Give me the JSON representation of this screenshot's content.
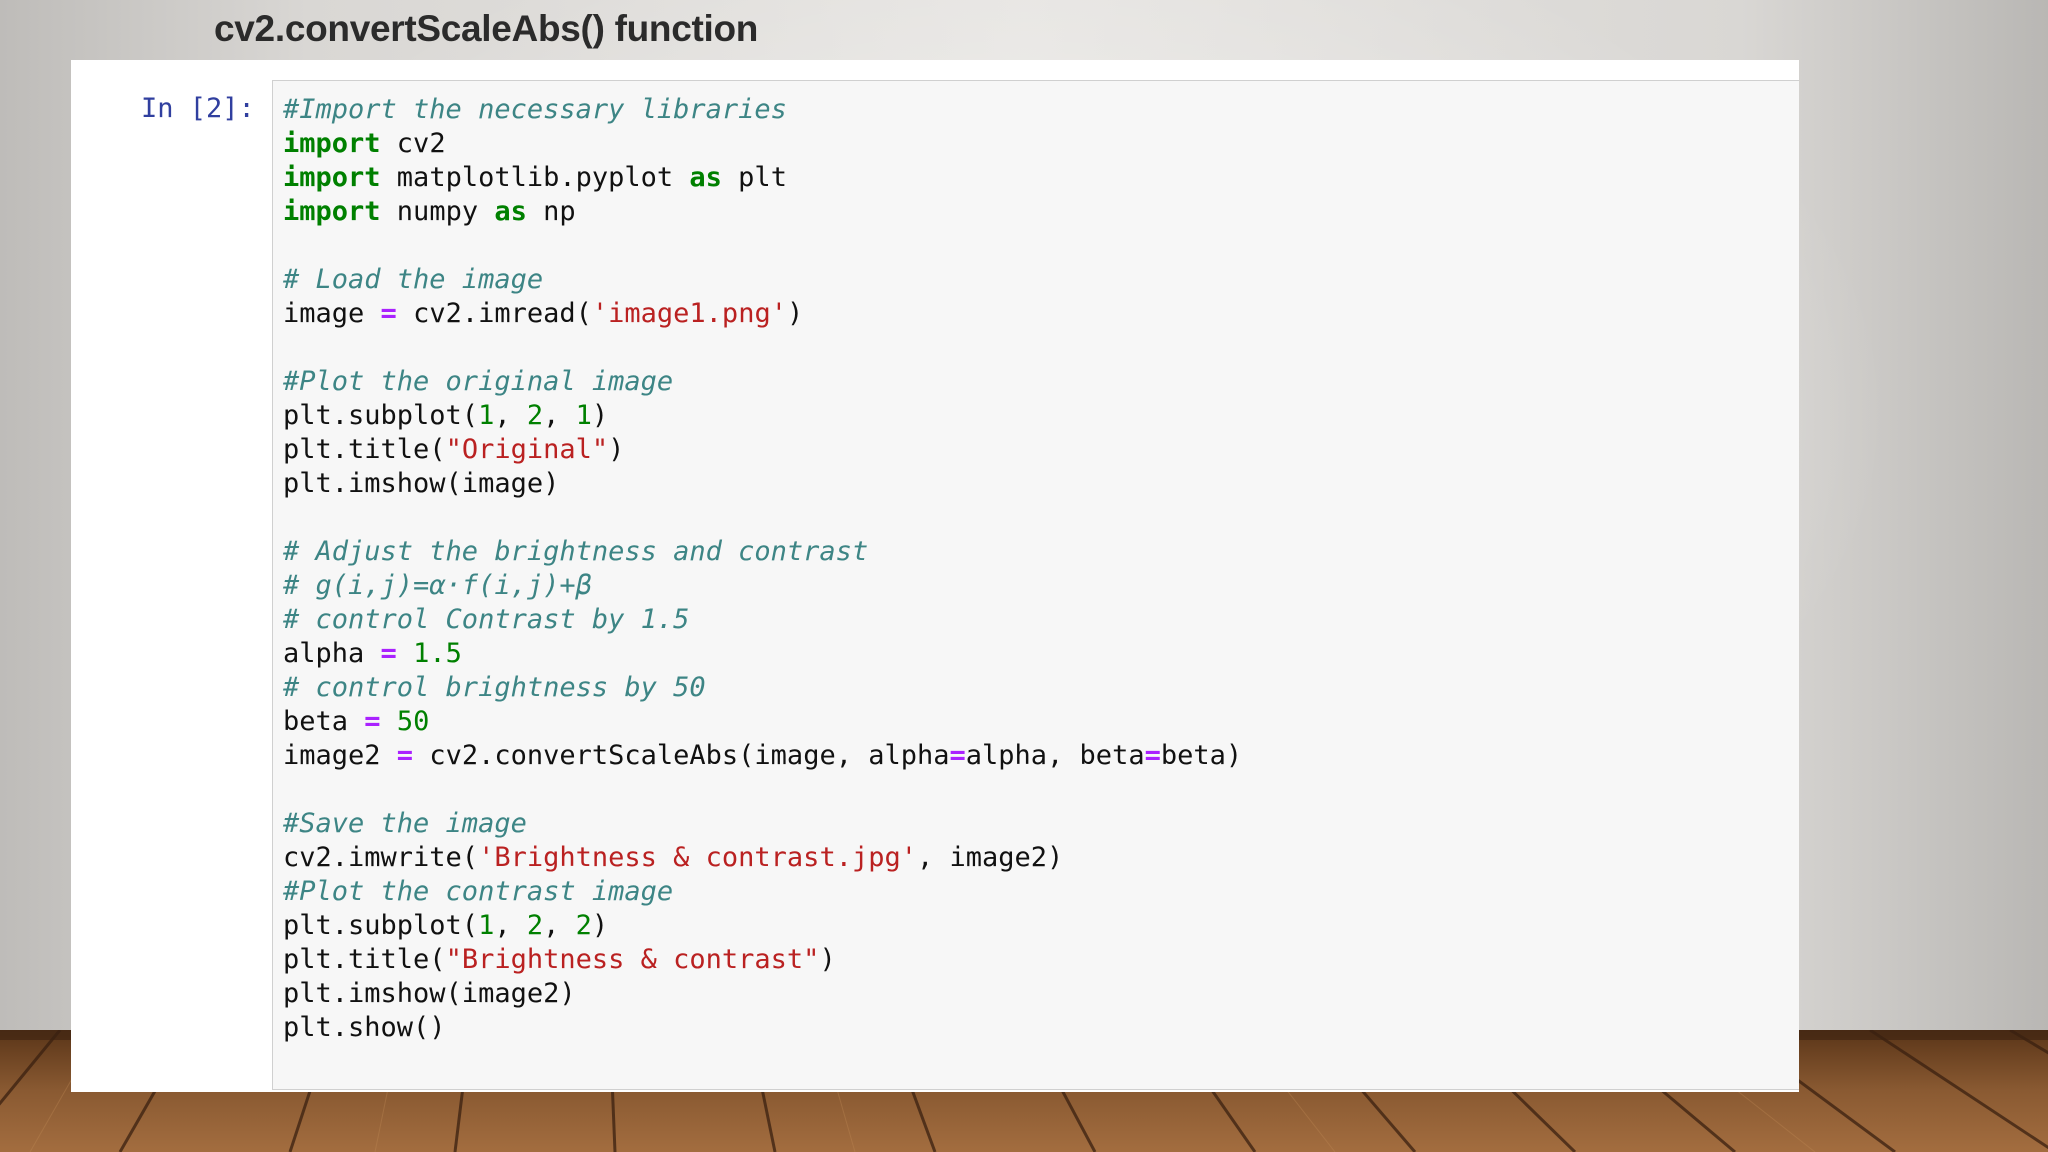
{
  "slide": {
    "title": "cv2.convertScaleAbs() function"
  },
  "cell": {
    "prompt": "In [2]:",
    "lines": [
      [
        {
          "t": "comment",
          "v": "#Import the necessary libraries"
        }
      ],
      [
        {
          "t": "keyword",
          "v": "import"
        },
        {
          "t": "text",
          "v": " cv2"
        }
      ],
      [
        {
          "t": "keyword",
          "v": "import"
        },
        {
          "t": "text",
          "v": " matplotlib.pyplot "
        },
        {
          "t": "keyword",
          "v": "as"
        },
        {
          "t": "text",
          "v": " plt"
        }
      ],
      [
        {
          "t": "keyword",
          "v": "import"
        },
        {
          "t": "text",
          "v": " numpy "
        },
        {
          "t": "keyword",
          "v": "as"
        },
        {
          "t": "text",
          "v": " np"
        }
      ],
      [],
      [
        {
          "t": "comment",
          "v": "# Load the image"
        }
      ],
      [
        {
          "t": "text",
          "v": "image "
        },
        {
          "t": "operator",
          "v": "="
        },
        {
          "t": "text",
          "v": " cv2.imread("
        },
        {
          "t": "string",
          "v": "'image1.png'"
        },
        {
          "t": "text",
          "v": ")"
        }
      ],
      [],
      [
        {
          "t": "comment",
          "v": "#Plot the original image"
        }
      ],
      [
        {
          "t": "text",
          "v": "plt.subplot("
        },
        {
          "t": "number",
          "v": "1"
        },
        {
          "t": "text",
          "v": ", "
        },
        {
          "t": "number",
          "v": "2"
        },
        {
          "t": "text",
          "v": ", "
        },
        {
          "t": "number",
          "v": "1"
        },
        {
          "t": "text",
          "v": ")"
        }
      ],
      [
        {
          "t": "text",
          "v": "plt.title("
        },
        {
          "t": "string",
          "v": "\"Original\""
        },
        {
          "t": "text",
          "v": ")"
        }
      ],
      [
        {
          "t": "text",
          "v": "plt.imshow(image)"
        }
      ],
      [],
      [
        {
          "t": "comment",
          "v": "# Adjust the brightness and contrast"
        }
      ],
      [
        {
          "t": "comment",
          "v": "# g(i,j)=α·f(i,j)+β"
        }
      ],
      [
        {
          "t": "comment",
          "v": "# control Contrast by 1.5"
        }
      ],
      [
        {
          "t": "text",
          "v": "alpha "
        },
        {
          "t": "operator",
          "v": "="
        },
        {
          "t": "text",
          "v": " "
        },
        {
          "t": "number",
          "v": "1.5"
        }
      ],
      [
        {
          "t": "comment",
          "v": "# control brightness by 50"
        }
      ],
      [
        {
          "t": "text",
          "v": "beta "
        },
        {
          "t": "operator",
          "v": "="
        },
        {
          "t": "text",
          "v": " "
        },
        {
          "t": "number",
          "v": "50"
        }
      ],
      [
        {
          "t": "text",
          "v": "image2 "
        },
        {
          "t": "operator",
          "v": "="
        },
        {
          "t": "text",
          "v": " cv2.convertScaleAbs(image, alpha"
        },
        {
          "t": "operator",
          "v": "="
        },
        {
          "t": "text",
          "v": "alpha, beta"
        },
        {
          "t": "operator",
          "v": "="
        },
        {
          "t": "text",
          "v": "beta)"
        }
      ],
      [],
      [
        {
          "t": "comment",
          "v": "#Save the image"
        }
      ],
      [
        {
          "t": "text",
          "v": "cv2.imwrite("
        },
        {
          "t": "string",
          "v": "'Brightness & contrast.jpg'"
        },
        {
          "t": "text",
          "v": ", image2)"
        }
      ],
      [
        {
          "t": "comment",
          "v": "#Plot the contrast image"
        }
      ],
      [
        {
          "t": "text",
          "v": "plt.subplot("
        },
        {
          "t": "number",
          "v": "1"
        },
        {
          "t": "text",
          "v": ", "
        },
        {
          "t": "number",
          "v": "2"
        },
        {
          "t": "text",
          "v": ", "
        },
        {
          "t": "number",
          "v": "2"
        },
        {
          "t": "text",
          "v": ")"
        }
      ],
      [
        {
          "t": "text",
          "v": "plt.title("
        },
        {
          "t": "string",
          "v": "\"Brightness & contrast\""
        },
        {
          "t": "text",
          "v": ")"
        }
      ],
      [
        {
          "t": "text",
          "v": "plt.imshow(image2)"
        }
      ],
      [
        {
          "t": "text",
          "v": "plt.show()"
        }
      ]
    ]
  },
  "colors": {
    "comment": "#3d8585",
    "keyword": "#008000",
    "string": "#ba2121",
    "number": "#008000",
    "operator": "#aa22ff",
    "prompt": "#303f9f"
  }
}
